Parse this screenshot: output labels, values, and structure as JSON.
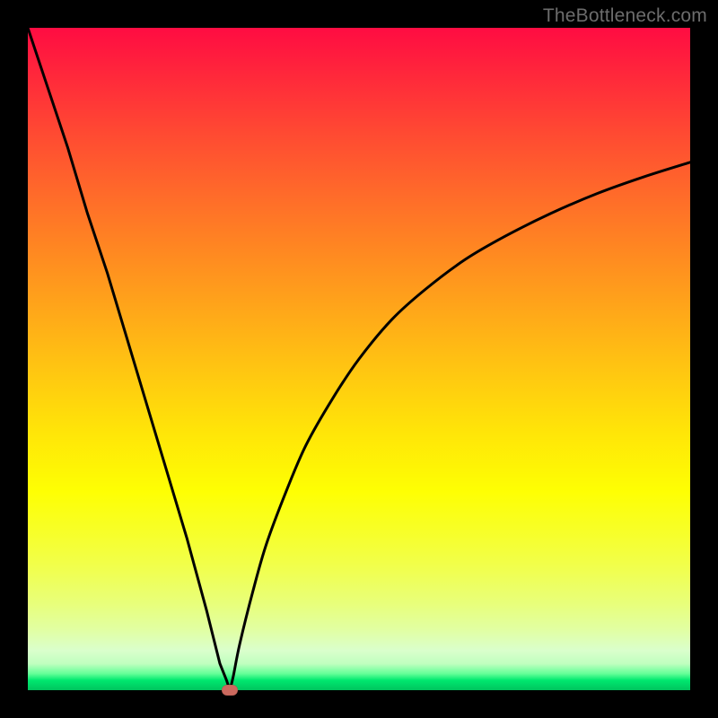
{
  "watermark_text": "TheBottleneck.com",
  "colors": {
    "frame": "#000000",
    "dot_fill": "#cb695e",
    "curve_stroke": "#000000"
  },
  "chart_data": {
    "type": "line",
    "title": "",
    "xlabel": "",
    "ylabel": "",
    "xlim": [
      0,
      100
    ],
    "ylim": [
      0,
      100
    ],
    "grid": false,
    "legend": false,
    "minimum_marker": {
      "x": 30.5,
      "y": 0
    },
    "series": [
      {
        "name": "left-branch",
        "x": [
          0,
          3,
          6,
          9,
          12,
          15,
          18,
          21,
          24,
          27,
          29,
          30,
          30.5
        ],
        "values": [
          100,
          91,
          82,
          72,
          63,
          53,
          43,
          33,
          23,
          12,
          4,
          1.5,
          0
        ]
      },
      {
        "name": "right-branch",
        "x": [
          30.5,
          31,
          32,
          34,
          36,
          39,
          42,
          46,
          50,
          55,
          60,
          66,
          72,
          79,
          86,
          93,
          100
        ],
        "values": [
          0,
          2,
          7,
          15,
          22,
          30,
          37,
          44,
          50,
          56,
          60.5,
          65,
          68.5,
          72,
          75,
          77.5,
          79.7
        ]
      }
    ]
  }
}
